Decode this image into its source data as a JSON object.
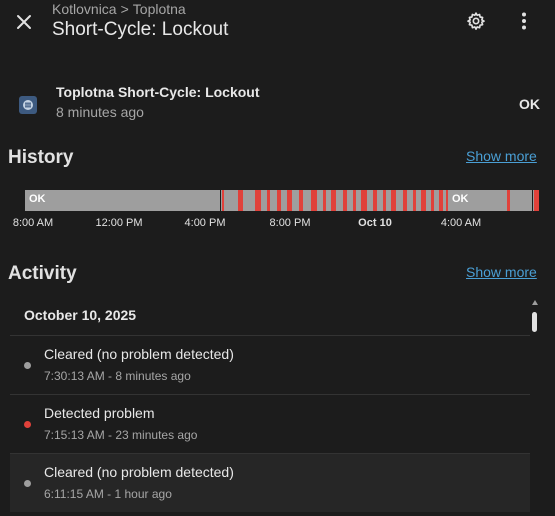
{
  "header": {
    "breadcrumb": [
      "Kotlovnica",
      "Toplotna"
    ],
    "breadcrumb_sep": ">",
    "title": "Short-Cycle: Lockout"
  },
  "entity": {
    "icon": "binary-sensor-icon",
    "name": "Toplotna Short-Cycle: Lockout",
    "last_changed": "8 minutes ago",
    "state": "OK"
  },
  "history": {
    "title": "History",
    "show_more": "Show more",
    "timeline_labels": [
      "OK",
      "OK"
    ],
    "ticks": [
      "8:00 AM",
      "12:00 PM",
      "4:00 PM",
      "8:00 PM",
      "Oct 10",
      "4:00 AM"
    ],
    "colors": {
      "ok": "#9e9e9e",
      "problem": "#e0413a"
    }
  },
  "activity": {
    "title": "Activity",
    "show_more": "Show more",
    "date": "October 10, 2025",
    "items": [
      {
        "message": "Cleared (no problem detected)",
        "time": "7:30:13 AM - 8 minutes ago",
        "status": "cleared"
      },
      {
        "message": "Detected problem",
        "time": "7:15:13 AM - 23 minutes ago",
        "status": "problem"
      },
      {
        "message": "Cleared (no problem detected)",
        "time": "6:11:15 AM - 1 hour ago",
        "status": "cleared"
      }
    ]
  }
}
